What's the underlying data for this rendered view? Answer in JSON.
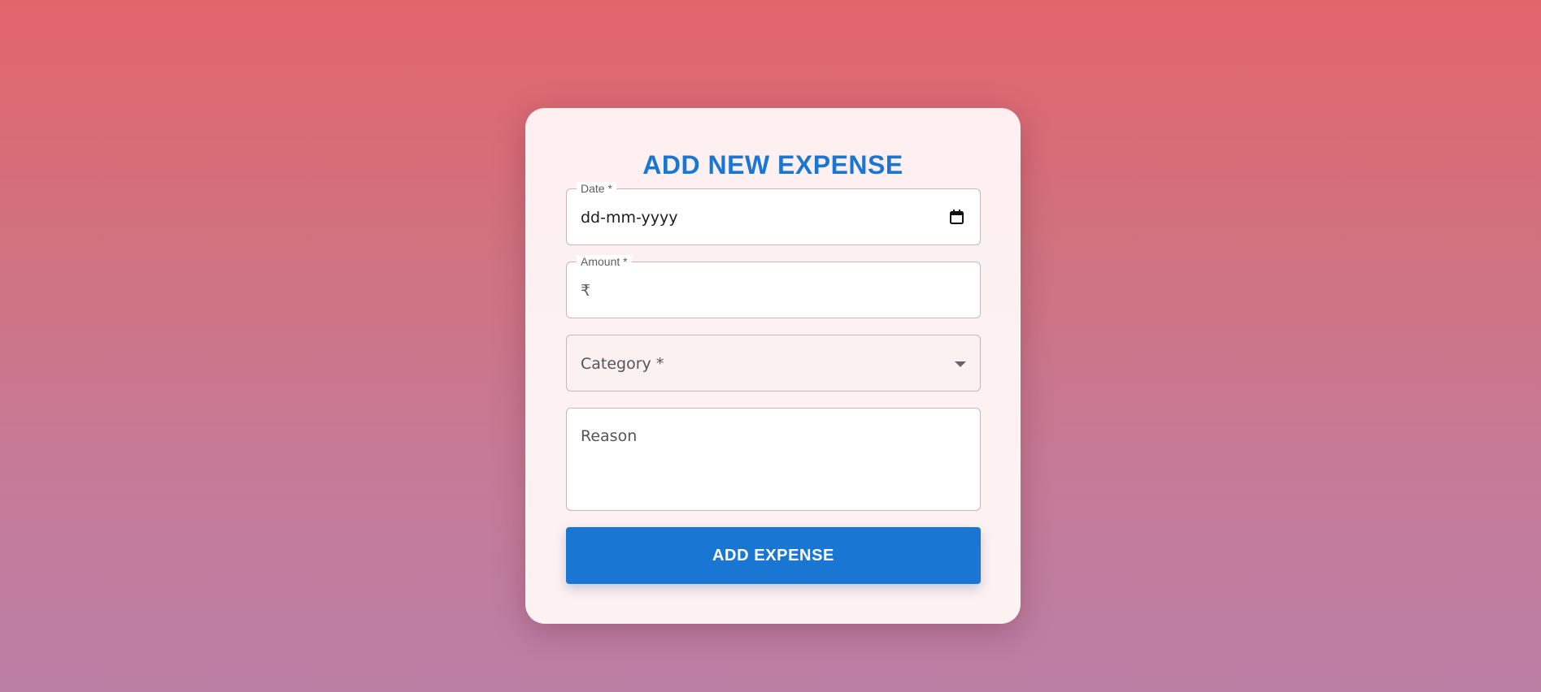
{
  "form": {
    "title": "ADD NEW EXPENSE",
    "date": {
      "label": "Date *",
      "value": "dd-mm-yyyy",
      "icon": "calendar-icon"
    },
    "amount": {
      "label": "Amount *",
      "currency_symbol": "₹",
      "value": ""
    },
    "category": {
      "placeholder": "Category *",
      "selected": "",
      "icon": "chevron-down-icon"
    },
    "reason": {
      "placeholder": "Reason",
      "value": ""
    },
    "submit_label": "ADD EXPENSE"
  },
  "colors": {
    "accent": "#1976d2",
    "background_top": "#e3656b",
    "background_bottom": "#bb7fa5",
    "card": "#fff6f6"
  }
}
